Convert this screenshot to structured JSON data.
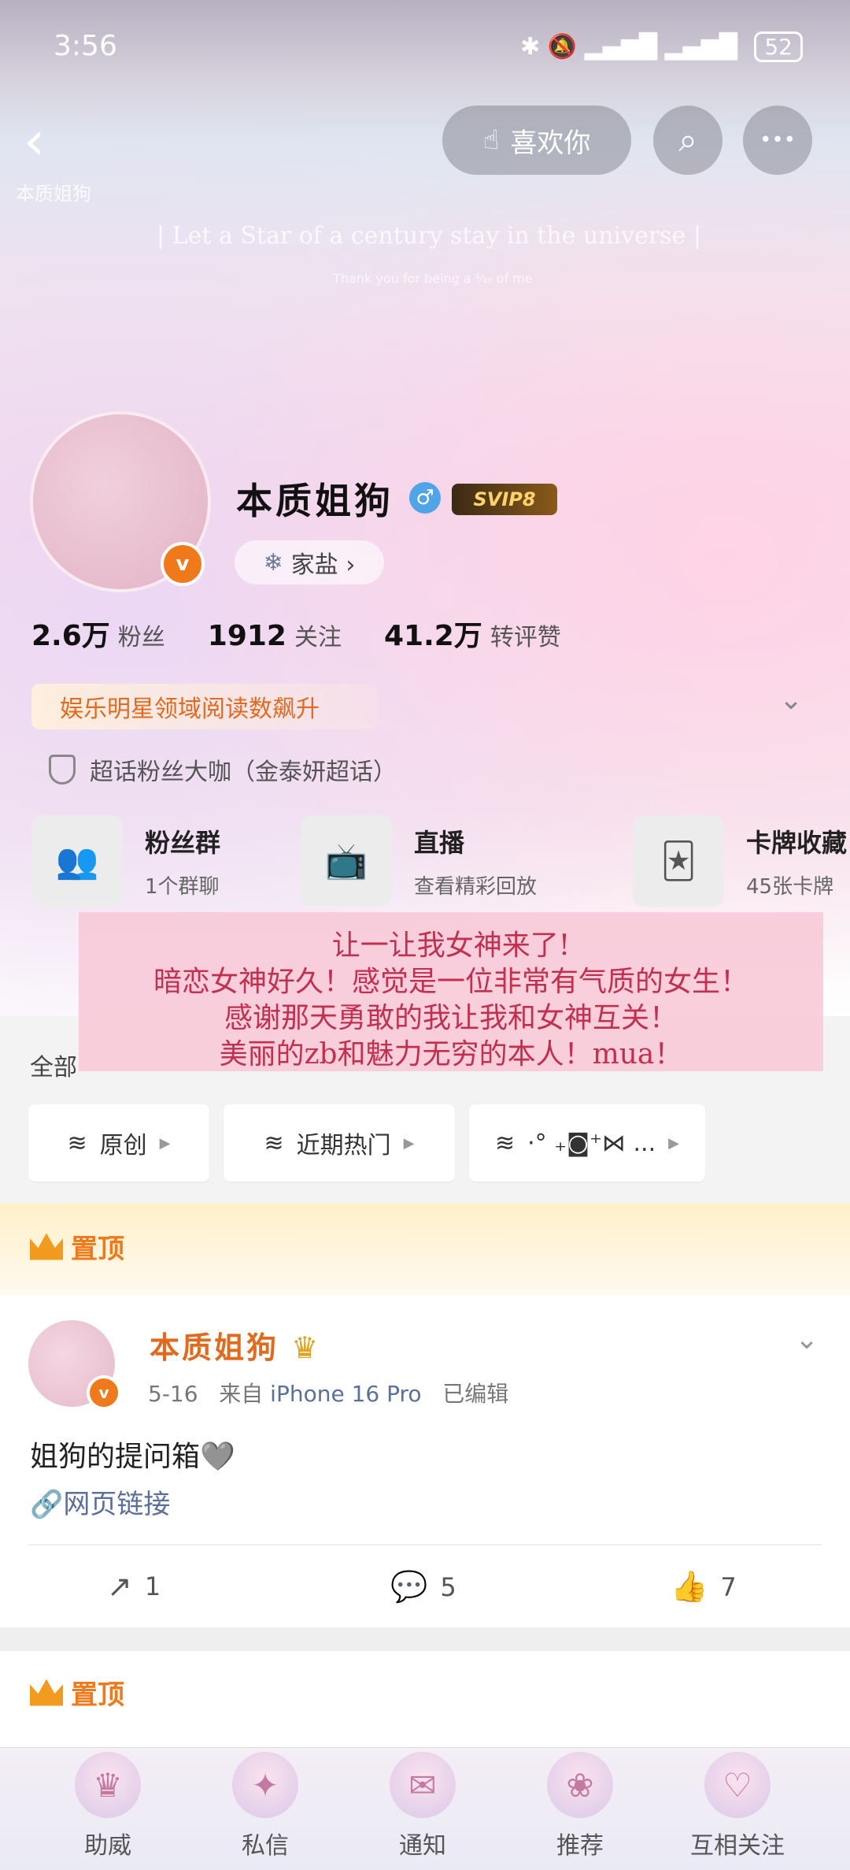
{
  "status": {
    "time": "3:56",
    "battery": "52"
  },
  "header": {
    "back_label": "‹",
    "like_label": "喜欢你",
    "search_icon": "⌕",
    "more_icon": "•••",
    "watermark_name": "本质姐狗",
    "tagline": "| Let a Star of a century stay in the universe |",
    "tagline_sub": "Thank you for being a ⅟₁₀ of me"
  },
  "profile": {
    "name": "本质姐狗",
    "gender_symbol": "♂",
    "svip": "SVIP8",
    "v_badge": "v",
    "family": "家盐 ›",
    "stats": [
      {
        "num": "2.6万",
        "label": "粉丝"
      },
      {
        "num": "1912",
        "label": "关注"
      },
      {
        "num": "41.2万",
        "label": "转评赞"
      }
    ],
    "reading_tag": "娱乐明星领域阅读数飙升",
    "superfan": "超话粉丝大咖（金泰妍超话）"
  },
  "features": [
    {
      "icon": "👥",
      "title": "粉丝群",
      "sub": "1个群聊"
    },
    {
      "icon": "📺",
      "title": "直播",
      "sub": "查看精彩回放"
    },
    {
      "icon": "🃏",
      "title": "卡牌收藏",
      "sub": "45张卡牌"
    }
  ],
  "overlay_note": [
    "让一让我女神来了!",
    "暗恋女神好久！感觉是一位非常有气质的女生！",
    "感谢那天勇敢的我让我和女神互关！",
    "美丽的zb和魅力无穷的本人！mua！"
  ],
  "filter": {
    "all_label": "全部",
    "chips": [
      {
        "icon": "≋",
        "label": "原创"
      },
      {
        "icon": "≋",
        "label": "近期热门"
      },
      {
        "icon": "≋",
        "label": "·° ₊◙⁺⋈ ..."
      }
    ]
  },
  "pinned_label": "置顶",
  "post": {
    "author": "本质姐狗",
    "date": "5-16",
    "from": "来自",
    "device": "iPhone 16 Pro",
    "edited": "已编辑",
    "text": "姐狗的提问箱🩶",
    "link": "🔗网页链接",
    "repost_count": "1",
    "comment_count": "5",
    "like_count": "7"
  },
  "tabs": [
    {
      "icon": "♛",
      "label": "助威"
    },
    {
      "icon": "✦",
      "label": "私信"
    },
    {
      "icon": "✉",
      "label": "通知"
    },
    {
      "icon": "❀",
      "label": "推荐"
    },
    {
      "icon": "♡",
      "label": "互相关注"
    }
  ]
}
